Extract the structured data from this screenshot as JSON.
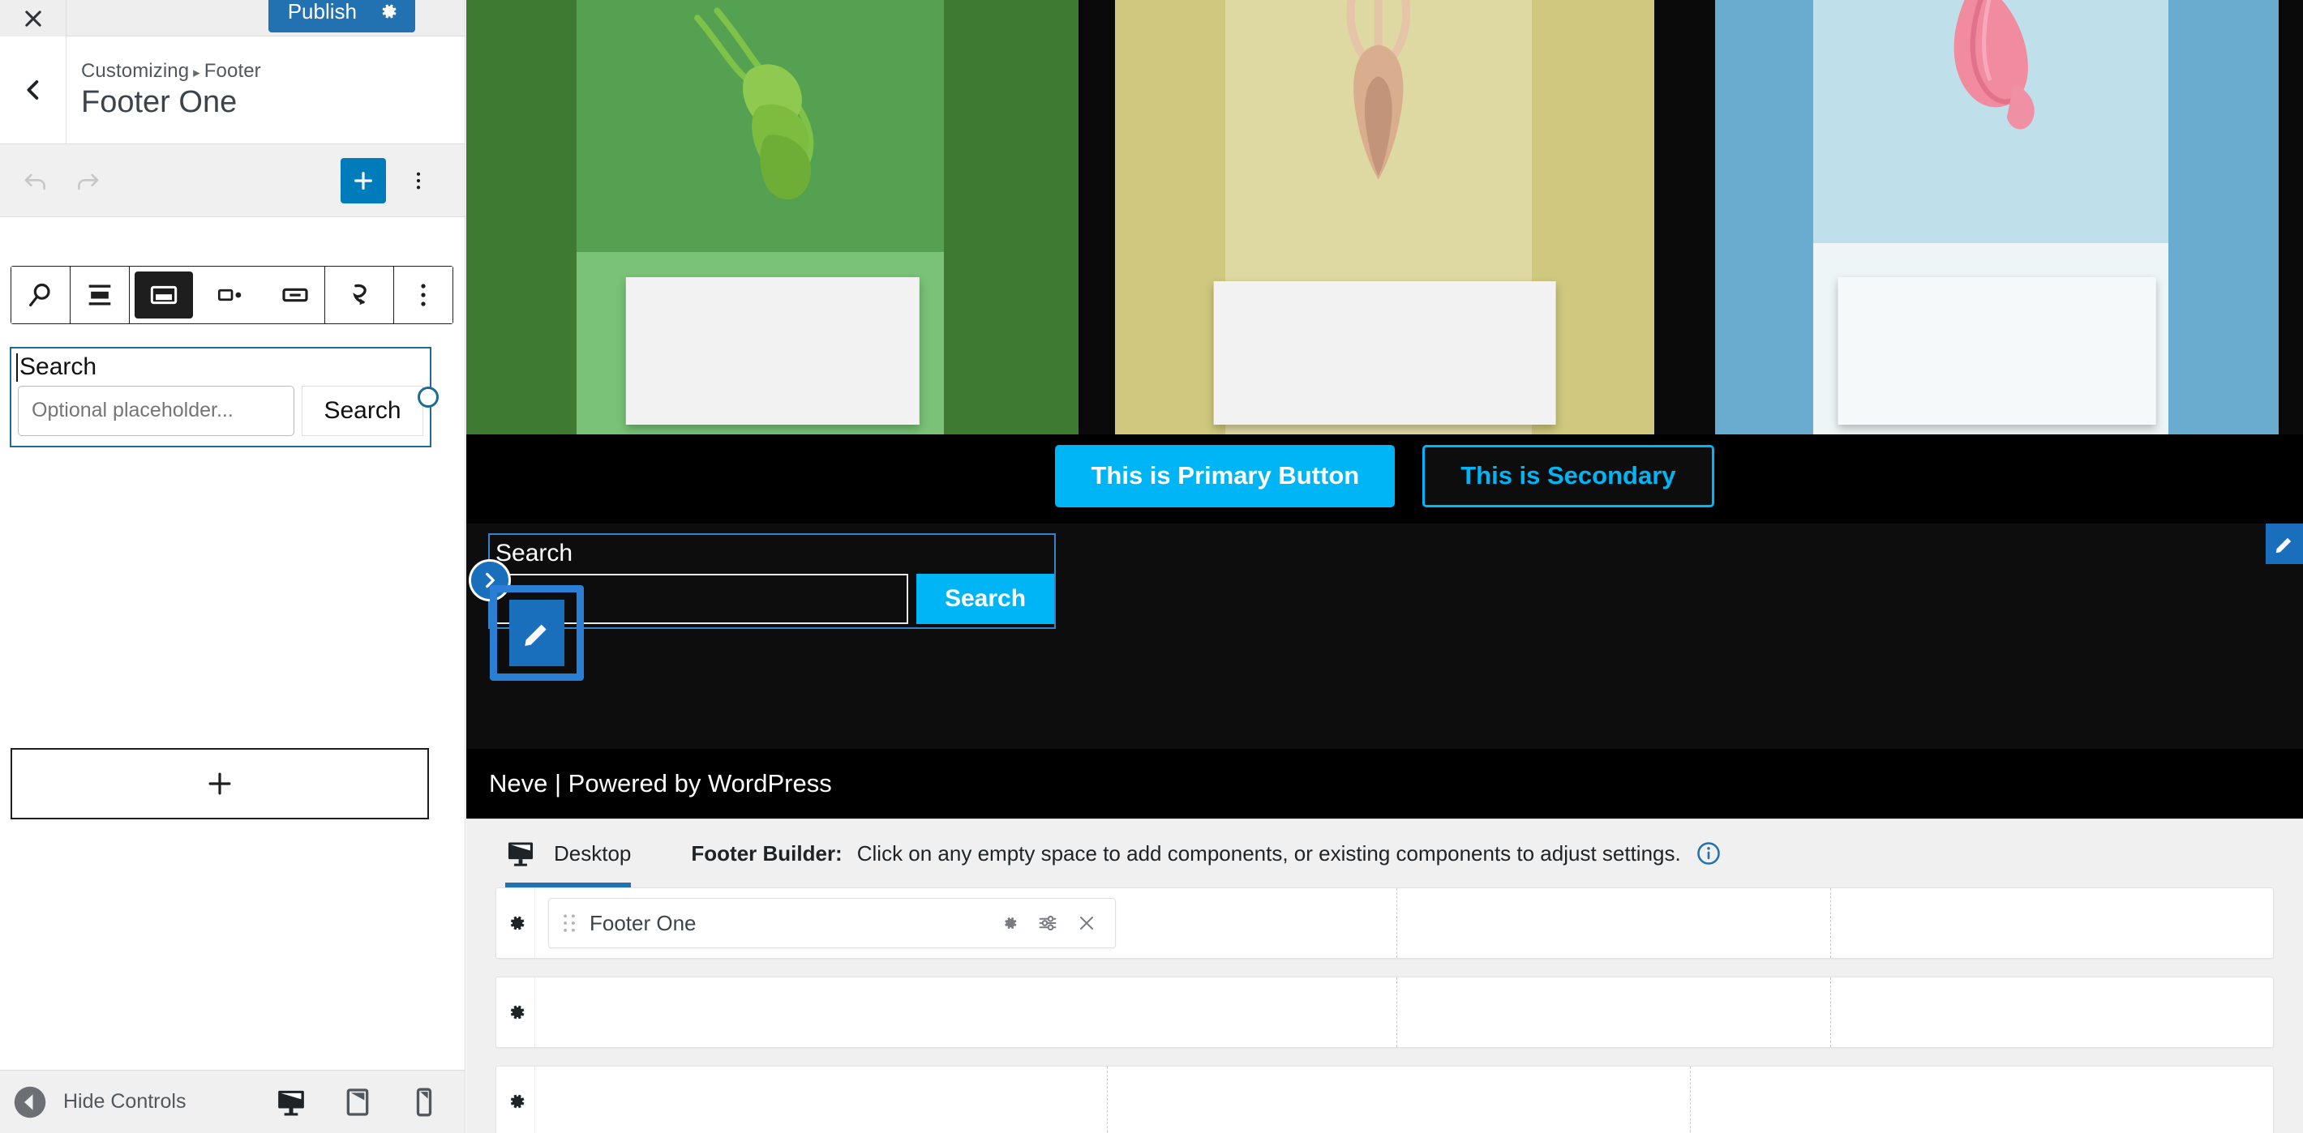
{
  "customizer": {
    "close_label": "Close",
    "publish_label": "Publish",
    "publish_settings_icon": "gear-icon",
    "breadcrumb_root": "Customizing",
    "breadcrumb_sep": "▸",
    "breadcrumb_current": "Footer",
    "panel_title": "Footer One",
    "collapse_label": "Hide Controls",
    "devices": [
      {
        "name": "desktop",
        "icon": "desktop-icon",
        "active": true
      },
      {
        "name": "tablet",
        "icon": "tablet-icon",
        "active": false
      },
      {
        "name": "mobile",
        "icon": "mobile-icon",
        "active": false
      }
    ],
    "accent_blue": "#2271b1"
  },
  "editor_bar": {
    "undo_icon": "undo-icon",
    "redo_icon": "redo-icon",
    "add_block_icon": "plus-icon",
    "options_icon": "kebab-menu-icon"
  },
  "block_toolbar": {
    "items": [
      {
        "name": "block-type-search",
        "icon": "search-icon",
        "active": false
      },
      {
        "name": "align",
        "icon": "align-center-icon",
        "active": false
      },
      {
        "name": "button-position-inside",
        "icon": "button-inside-icon",
        "active": true
      },
      {
        "name": "button-position-outside",
        "icon": "button-outside-icon",
        "active": false
      },
      {
        "name": "button-only",
        "icon": "button-only-icon",
        "active": false
      },
      {
        "name": "use-button-with-icon",
        "icon": "arrow-curve-icon",
        "active": false
      },
      {
        "name": "block-options",
        "icon": "kebab-menu-icon",
        "active": false
      }
    ]
  },
  "search_block": {
    "label": "Search",
    "input_placeholder": "Optional placeholder...",
    "button_label": "Search",
    "selection_color": "#1e6b96"
  },
  "block_appender": {
    "icon": "plus-icon",
    "label": ""
  },
  "preview": {
    "primary_button": "This is Primary Button",
    "secondary_button": "This is Secondary",
    "primary_color": "#00b5f5",
    "footer_search": {
      "title": "Search",
      "button_label": "Search",
      "input_value": ""
    },
    "copyright": "Neve | Powered by WordPress",
    "edit_icon": "pencil-icon",
    "expand_icon": "chevron-right-icon"
  },
  "footer_builder": {
    "device_tab": "Desktop",
    "device_tab_icon": "desktop-icon",
    "hint_label": "Footer Builder:",
    "hint_text": "Click on any empty space to add components, or existing components to adjust settings.",
    "info_icon": "info-icon",
    "rows": [
      {
        "name": "row-top",
        "gear_icon": "gear-icon",
        "columns": [
          {
            "component": {
              "label": "Footer One",
              "drag_icon": "drag-handle-icon",
              "settings_icon": "gear-icon",
              "sliders_icon": "sliders-icon",
              "remove_icon": "close-icon"
            }
          },
          {
            "component": null
          },
          {
            "component": null
          }
        ]
      },
      {
        "name": "row-main",
        "gear_icon": "gear-icon",
        "columns": [
          {
            "component": null
          },
          {
            "component": null
          },
          {
            "component": null
          }
        ]
      },
      {
        "name": "row-bottom",
        "gear_icon": "gear-icon",
        "columns": [
          {
            "component": null
          },
          {
            "component": null
          },
          {
            "component": null
          }
        ]
      }
    ]
  }
}
